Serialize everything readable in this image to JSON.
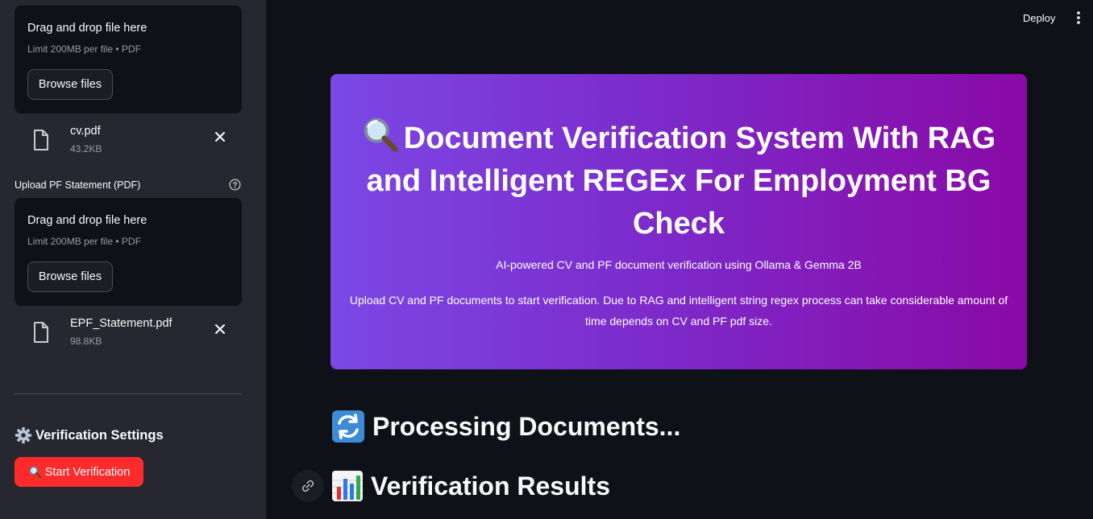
{
  "sidebar": {
    "cv_uploader": {
      "drop_title": "Drag and drop file here",
      "limit_text": "Limit 200MB per file • PDF",
      "browse_label": "Browse files",
      "file": {
        "name": "cv.pdf",
        "size": "43.2KB"
      }
    },
    "pf_uploader": {
      "label": "Upload PF Statement (PDF)",
      "drop_title": "Drag and drop file here",
      "limit_text": "Limit 200MB per file • PDF",
      "browse_label": "Browse files",
      "file": {
        "name": "EPF_Statement.pdf",
        "size": "98.8KB"
      }
    },
    "settings_title": "Verification Settings",
    "start_button_label": "Start Verification"
  },
  "header": {
    "deploy_label": "Deploy"
  },
  "hero": {
    "title": "Document Verification System With RAG and Intelligent REGEx For Employment BG Check",
    "subtitle": "AI-powered CV and PF document verification using Ollama & Gemma 2B",
    "description_line1": "Upload CV and PF documents to start verification. Due to RAG and intelligent string regex process can take considerable amount of",
    "description_line2": "time depends on CV and PF pdf size."
  },
  "main": {
    "processing_heading": "Processing Documents...",
    "results_heading": "Verification Results"
  },
  "colors": {
    "sidebar_bg": "#262730",
    "main_bg": "#0e1117",
    "accent_red": "#ff2b2b",
    "hero_gradient_start": "#7b48e6",
    "hero_gradient_end": "#8a0aa6"
  },
  "icons": {
    "file": "file-icon",
    "remove": "close-icon",
    "help": "help-circle-icon",
    "gear": "gear-icon",
    "magnifier": "magnifier-icon",
    "refresh": "refresh-icon",
    "chart": "bar-chart-icon",
    "link": "link-icon",
    "menu": "kebab-menu-icon"
  }
}
